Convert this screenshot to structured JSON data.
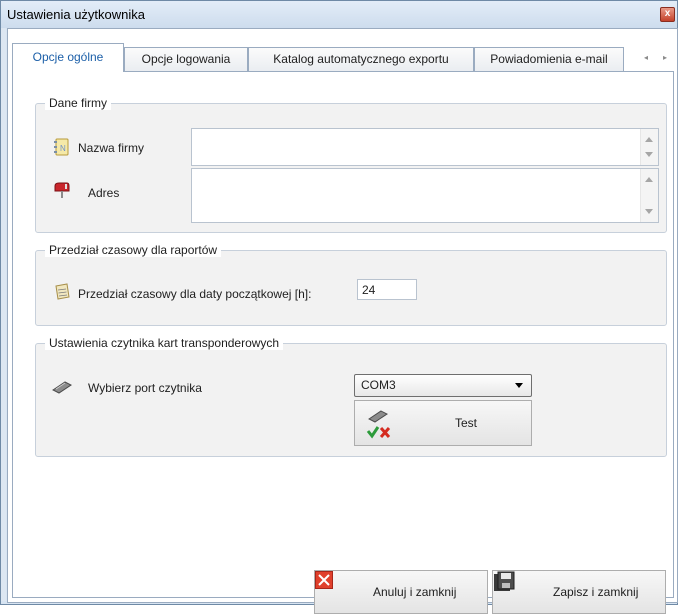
{
  "window": {
    "title": "Ustawienia użytkownika",
    "close_glyph": "x"
  },
  "tabs": [
    {
      "label": "Opcje ogólne",
      "active": true
    },
    {
      "label": "Opcje logowania"
    },
    {
      "label": "Katalog automatycznego exportu"
    },
    {
      "label": "Powiadomienia e-mail"
    }
  ],
  "tab_scroll": {
    "left": "◂",
    "right": "▸"
  },
  "company": {
    "group_title": "Dane firmy",
    "name_label": "Nazwa firmy",
    "name_value": "",
    "address_label": "Adres",
    "address_value": ""
  },
  "report": {
    "group_title": "Przedział czasowy dla raportów",
    "interval_label": "Przedział czasowy dla daty początkowej [h]:",
    "interval_value": "24"
  },
  "reader": {
    "group_title": "Ustawienia czytnika kart transponderowych",
    "port_label": "Wybierz port czytnika",
    "port_value": "COM3",
    "test_label": "Test"
  },
  "footer": {
    "cancel_label": "Anuluj i zamknij",
    "save_label": "Zapisz i zamknij"
  },
  "colors": {
    "active_tab_text": "#1c5fa8",
    "cancel_icon_bg": "#e0402c",
    "title_bar": "#cddced"
  }
}
